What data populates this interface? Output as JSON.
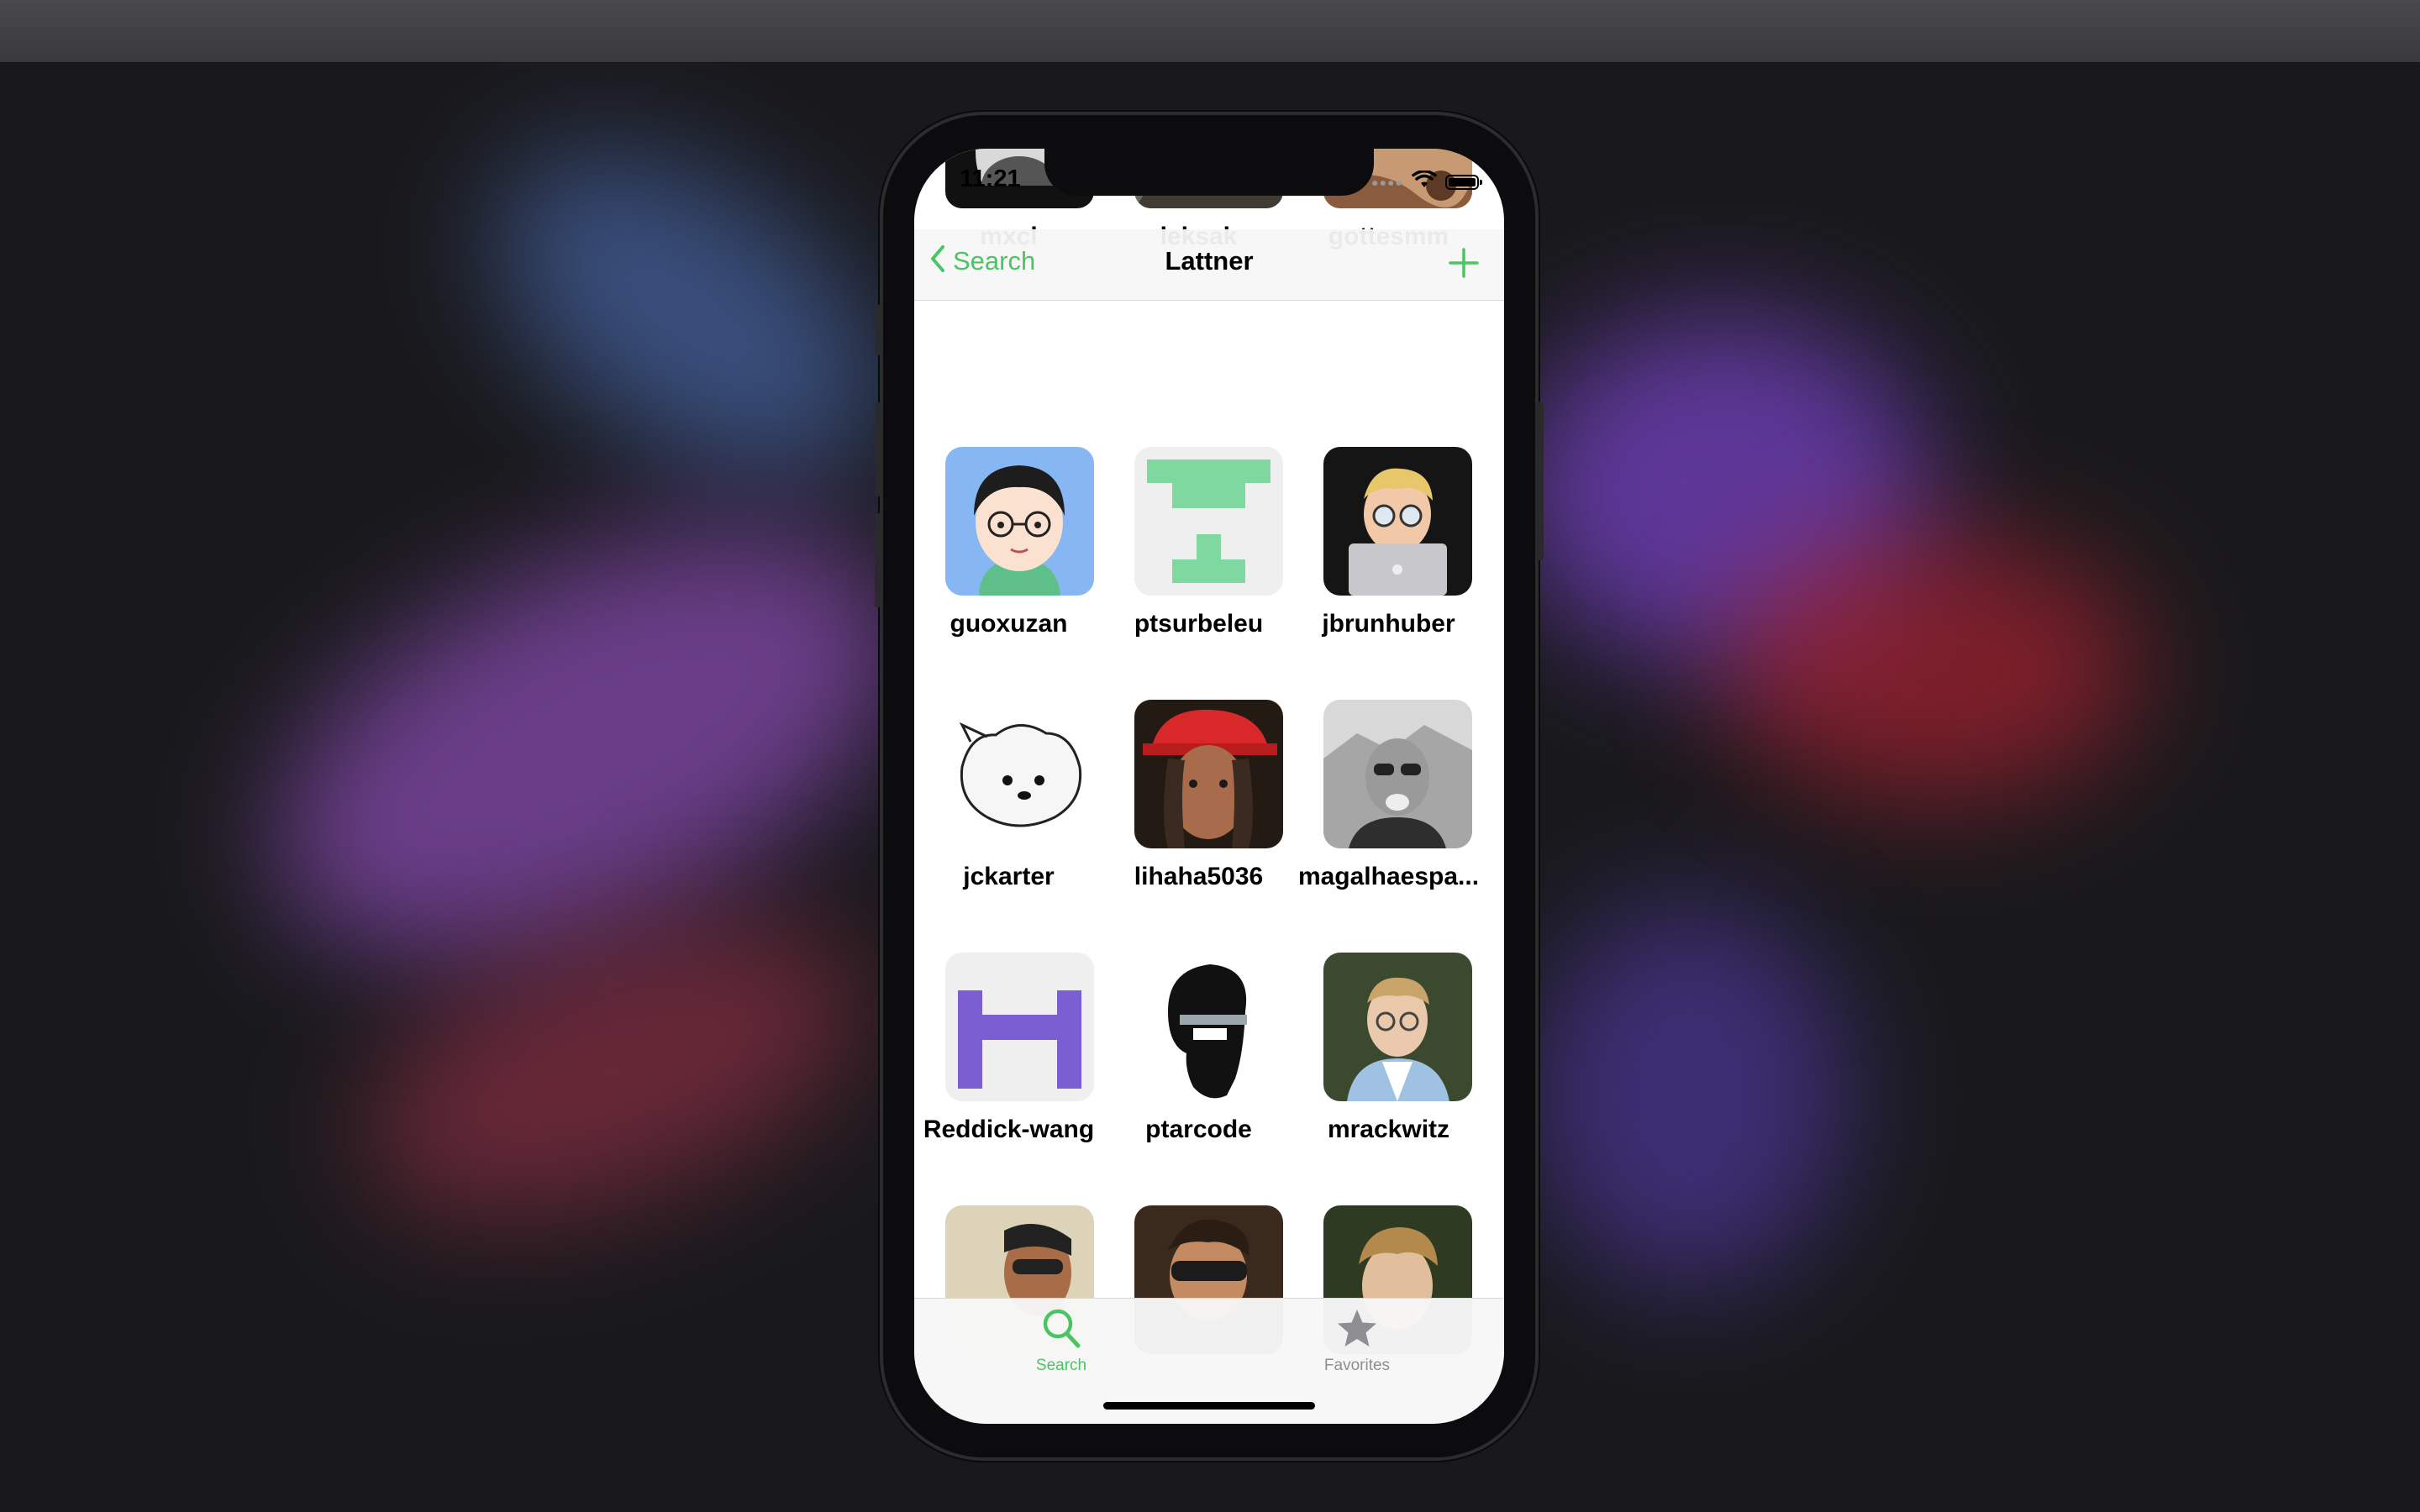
{
  "status": {
    "time": "11:21"
  },
  "nav": {
    "back_label": "Search",
    "title": "Lattner"
  },
  "users": [
    {
      "name": "mxcl"
    },
    {
      "name": "leksak"
    },
    {
      "name": "gottesmm"
    },
    {
      "name": "guoxuzan"
    },
    {
      "name": "ptsurbeleu"
    },
    {
      "name": "jbrunhuber"
    },
    {
      "name": "jckarter"
    },
    {
      "name": "lihaha5036"
    },
    {
      "name": "magalhaespa..."
    },
    {
      "name": "Reddick-wang"
    },
    {
      "name": "ptarcode"
    },
    {
      "name": "mrackwitz"
    },
    {
      "name": ""
    },
    {
      "name": ""
    },
    {
      "name": ""
    }
  ],
  "tabs": [
    {
      "label": "Search",
      "icon": "search-icon",
      "active": true
    },
    {
      "label": "Favorites",
      "icon": "star-icon",
      "active": false
    }
  ],
  "colors": {
    "accent": "#4cc463",
    "inactive": "#8e8e93"
  }
}
